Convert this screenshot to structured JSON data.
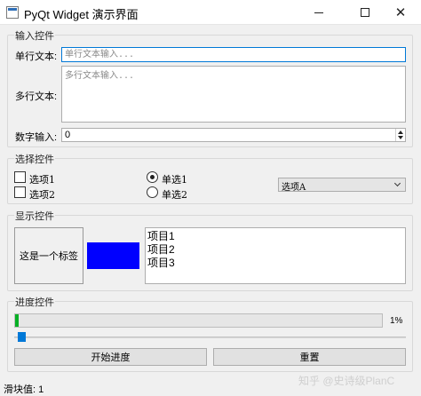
{
  "window": {
    "title": "PyQt Widget 演示界面",
    "minimize_glyph": "",
    "close_glyph": "✕"
  },
  "input_group": {
    "title": "输入控件",
    "line_label": "单行文本:",
    "line_placeholder": "单行文本输入...",
    "multi_label": "多行文本:",
    "multi_placeholder": "多行文本输入...",
    "number_label": "数字输入:",
    "number_value": "0"
  },
  "select_group": {
    "title": "选择控件",
    "checkbox1": "选项1",
    "checkbox2": "选项2",
    "radio1": "单选1",
    "radio2": "单选2",
    "combo_value": "选项A"
  },
  "display_group": {
    "title": "显示控件",
    "label_text": "这是一个标签",
    "color_block": "#0000ff",
    "list_items": [
      "项目1",
      "项目2",
      "项目3"
    ]
  },
  "progress_group": {
    "title": "进度控件",
    "progress": 1,
    "progress_text": "1%",
    "progress_color": "#06b025",
    "slider_color": "#0078d7",
    "start_button": "开始进度",
    "reset_button": "重置"
  },
  "status": {
    "text": "滑块值: 1"
  },
  "watermark": {
    "text": "知乎 @史诗级PlanC"
  }
}
